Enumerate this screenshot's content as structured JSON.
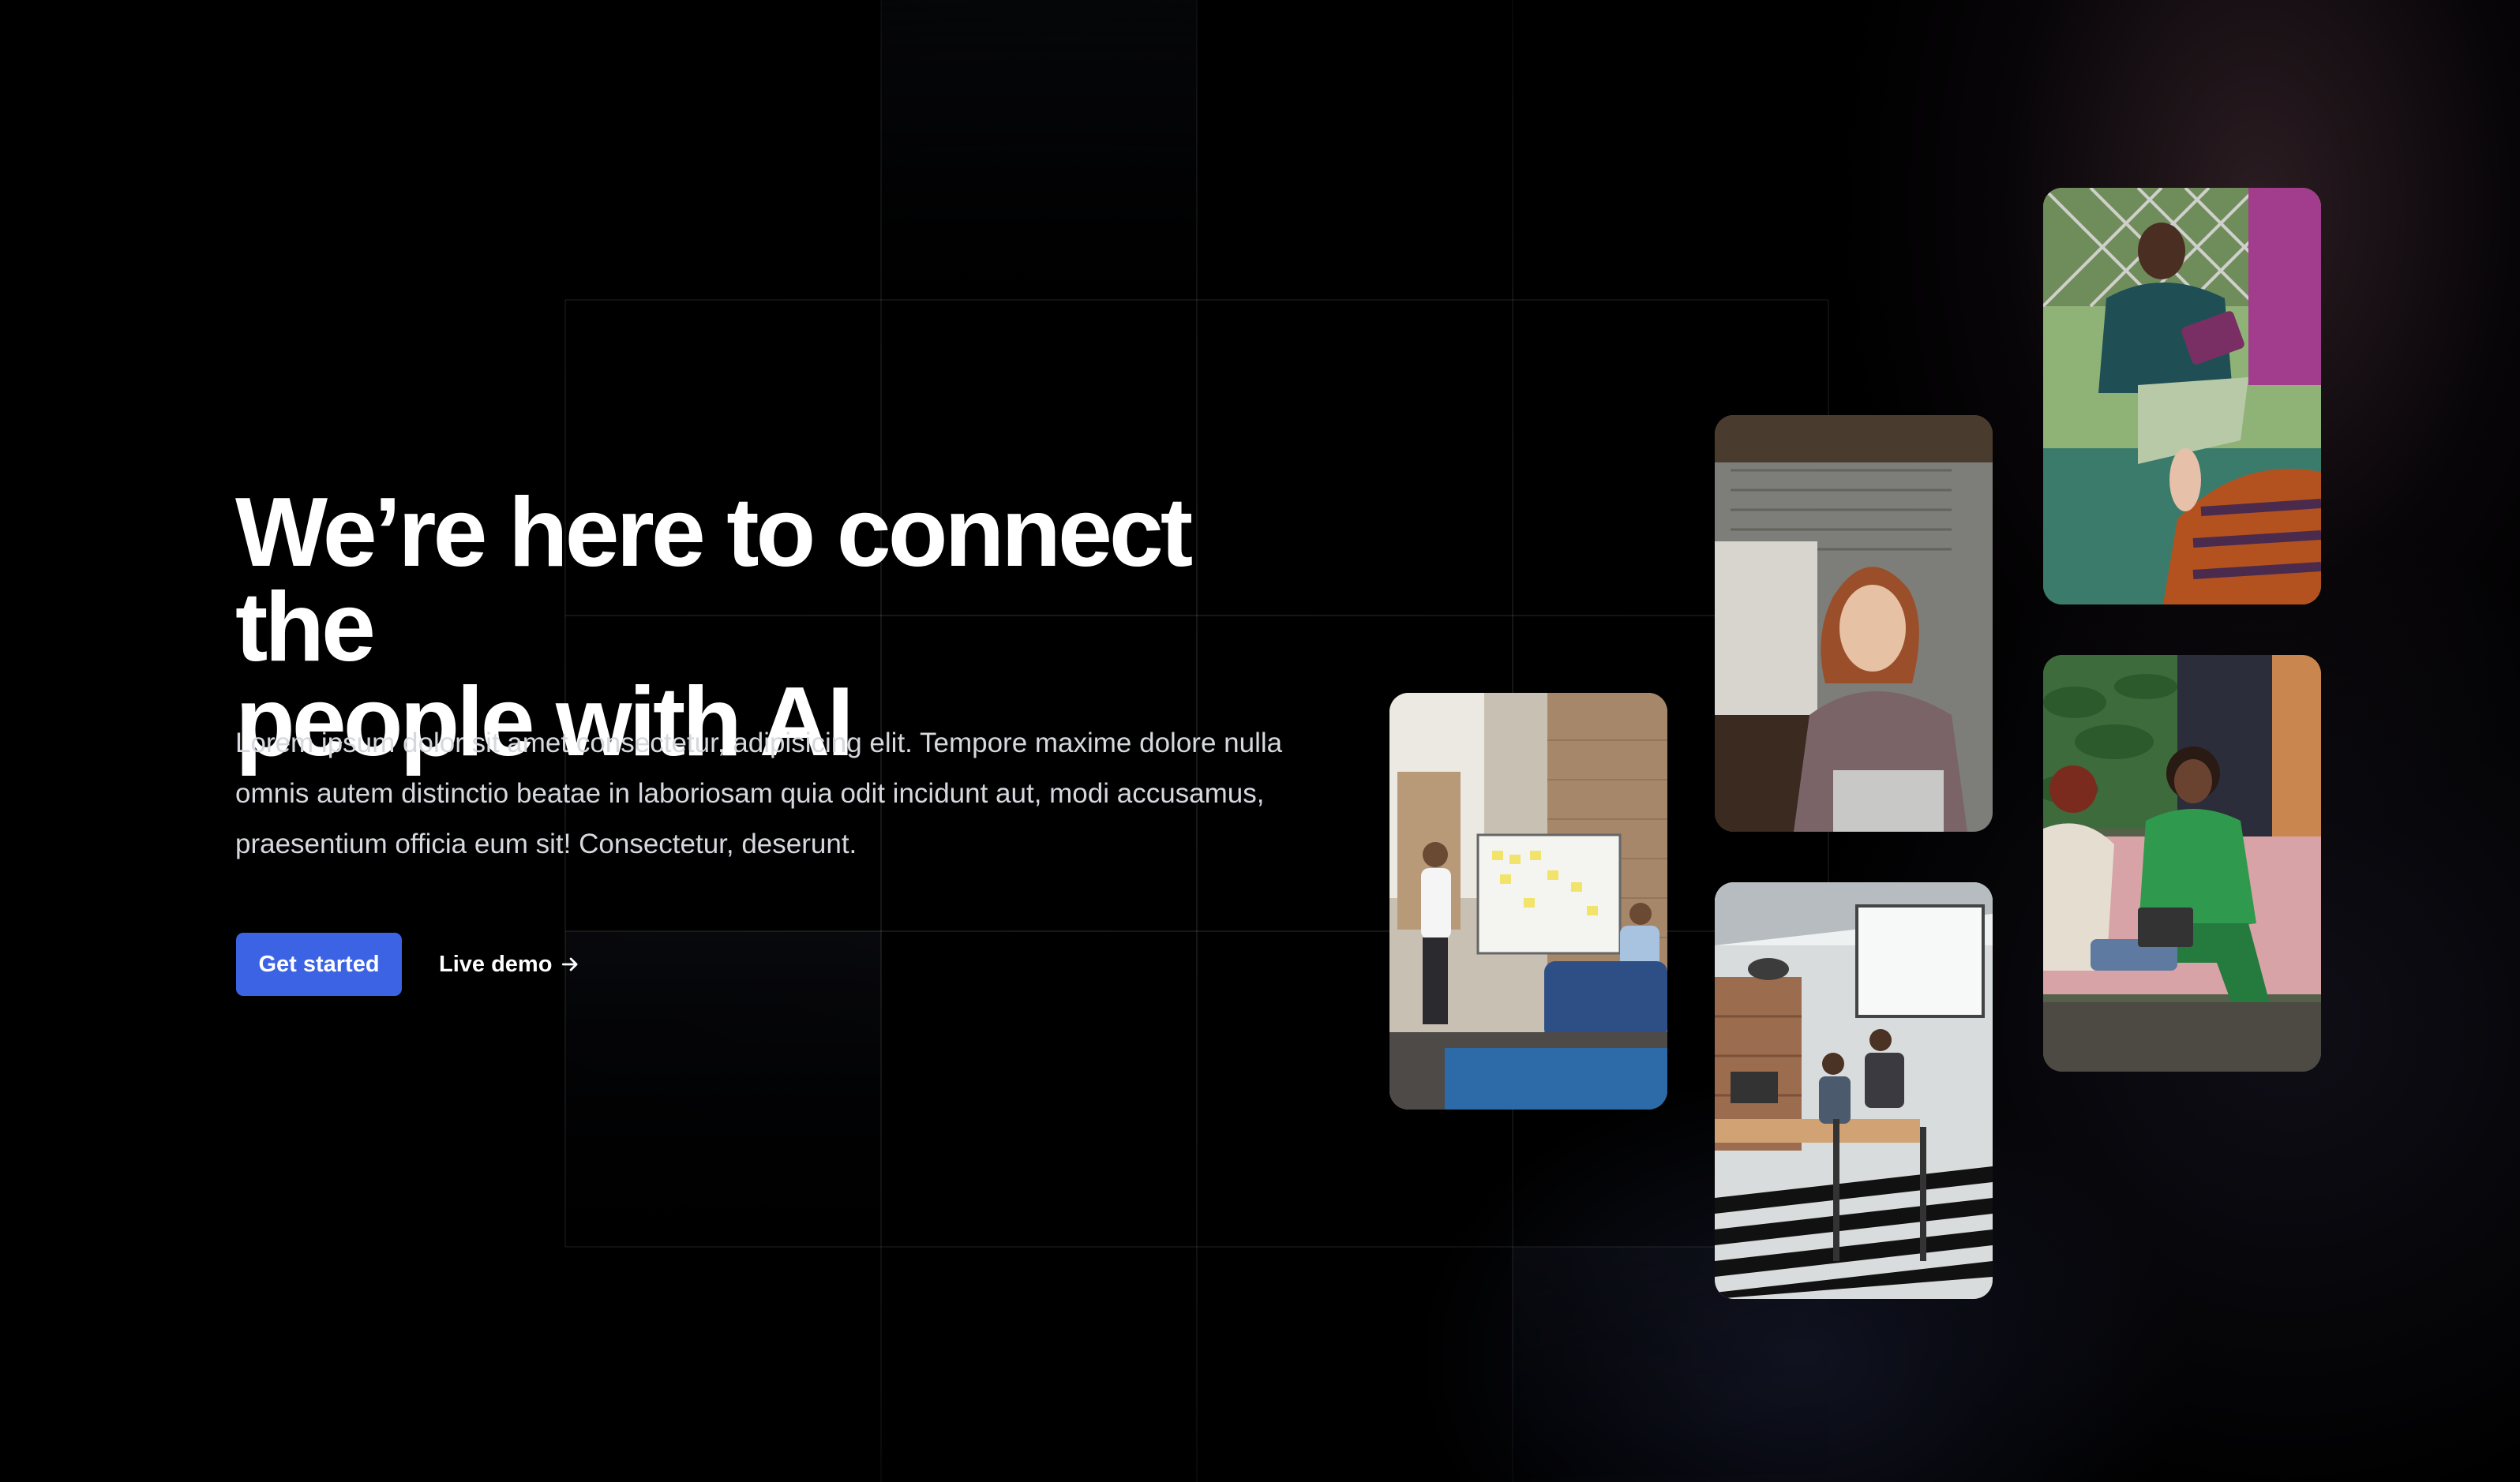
{
  "hero": {
    "title_line1": "We’re here to connect the",
    "title_line2": "people with AI",
    "description": "Lorem ipsum dolor sit amet consectetur, adipisicing elit. Tempore maxime dolore nulla omnis autem distinctio beatae in laboriosam quia odit incidunt aut, modi accusamus, praesentium officia eum sit! Consectetur, deserunt.",
    "primary_cta": "Get started",
    "secondary_cta": "Live demo"
  },
  "colors": {
    "background": "#000000",
    "primary_button": "#3c63e3",
    "text": "#ffffff",
    "muted_text": "#d6d8de"
  },
  "icons": {
    "secondary_cta": "arrow-right-icon"
  },
  "gallery": [
    {
      "name": "photo-team-whiteboard"
    },
    {
      "name": "photo-woman-laptop"
    },
    {
      "name": "photo-office-workspace"
    },
    {
      "name": "photo-man-tablet-meeting"
    },
    {
      "name": "photo-women-sofa-laughing"
    }
  ]
}
